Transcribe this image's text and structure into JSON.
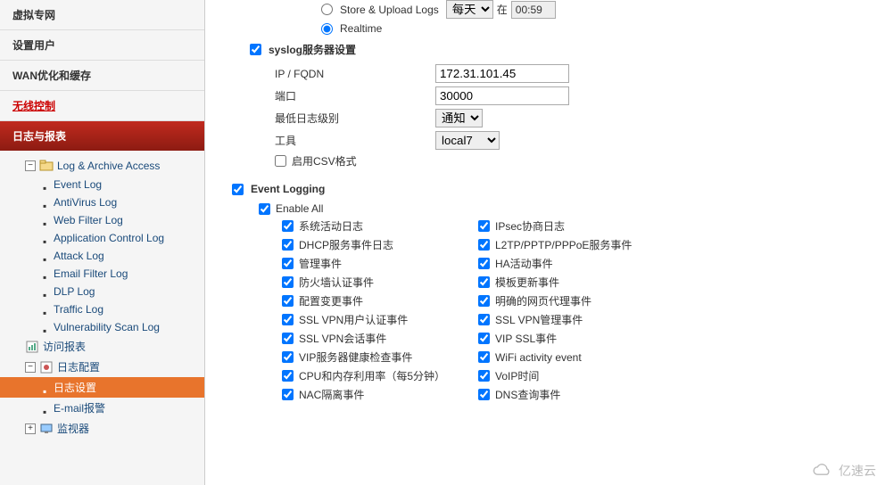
{
  "sidebar": {
    "top": [
      "虚拟专网",
      "设置用户",
      "WAN优化和缓存",
      "无线控制"
    ],
    "section_header": "日志与报表",
    "tree": {
      "log_archive": "Log & Archive Access",
      "items": [
        "Event Log",
        "AntiVirus Log",
        "Web Filter Log",
        "Application Control Log",
        "Attack Log",
        "Email Filter Log",
        "DLP Log",
        "Traffic Log",
        "Vulnerability Scan Log"
      ],
      "access_report": "访问报表",
      "log_config": "日志配置",
      "log_settings": "日志设置",
      "email_alert": "E-mail报警",
      "monitor": "监视器"
    }
  },
  "main": {
    "radio1": "Store & Upload Logs",
    "radio2": "Realtime",
    "time_sel": "每天",
    "time_at": "在",
    "time_val": "00:59",
    "syslog_section": "syslog服务器设置",
    "ip_label": "IP / FQDN",
    "ip_val": "172.31.101.45",
    "port_label": "端口",
    "port_val": "30000",
    "level_label": "最低日志级别",
    "level_val": "通知",
    "tool_label": "工具",
    "tool_val": "local7",
    "csv_label": "启用CSV格式",
    "event_logging_title": "Event Logging",
    "enable_all": "Enable All",
    "events_left": [
      "系统活动日志",
      "DHCP服务事件日志",
      "管理事件",
      "防火墙认证事件",
      "配置变更事件",
      "SSL VPN用户认证事件",
      "SSL VPN会话事件",
      "VIP服务器健康检查事件",
      "CPU和内存利用率（每5分钟）",
      "NAC隔离事件"
    ],
    "events_right": [
      "IPsec协商日志",
      "L2TP/PPTP/PPPoE服务事件",
      "HA活动事件",
      "模板更新事件",
      "明确的网页代理事件",
      "SSL VPN管理事件",
      "VIP SSL事件",
      "WiFi activity event",
      "VoIP时间",
      "DNS查询事件"
    ],
    "watermark": "亿速云"
  }
}
